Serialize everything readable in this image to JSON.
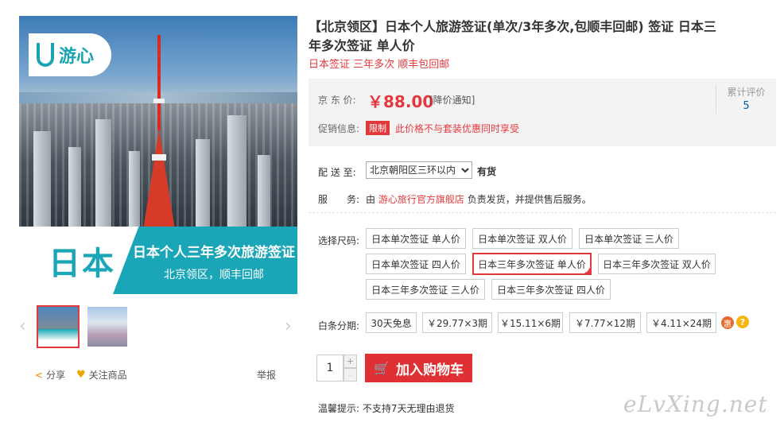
{
  "gallery": {
    "brand_logo": "游心",
    "banner_left": "日本",
    "banner_title": "日本个人三年多次旅游签证",
    "banner_subtitle": "北京领区，顺丰回邮"
  },
  "actions": {
    "share": "分享",
    "follow": "关注商品",
    "report": "举报"
  },
  "product": {
    "title": "【北京领区】日本个人旅游签证(单次/3年多次,包顺丰回邮) 签证 日本三年多次签证 单人价",
    "subtitle": "日本签证 三年多次 顺丰包回邮"
  },
  "price_section": {
    "label": "京 东 价:",
    "price": "￥88.00",
    "notice": "[降价通知]",
    "promo_label": "促销信息:",
    "promo_tag": "限制",
    "promo_text": "此价格不与套装优惠同时享受",
    "review_label": "累计评价",
    "review_count": "5"
  },
  "shipping": {
    "label": "配 送 至:",
    "location": "北京朝阳区三环以内",
    "stock": "有货",
    "service_label": "服　　务:",
    "service_prefix": "由",
    "shop_name": "游心旅行官方旗舰店",
    "service_suffix": "负责发货，并提供售后服务。"
  },
  "sizes": {
    "label": "选择尺码:",
    "options": [
      "日本单次签证 单人价",
      "日本单次签证 双人价",
      "日本单次签证 三人价",
      "日本单次签证 四人价",
      "日本三年多次签证 单人价",
      "日本三年多次签证 双人价",
      "日本三年多次签证 三人价",
      "日本三年多次签证 四人价"
    ],
    "selected_index": 4
  },
  "installments": {
    "label": "白条分期:",
    "options": [
      "30天免息",
      "￥29.77×3期",
      "￥15.11×6期",
      "￥7.77×12期",
      "￥4.11×24期"
    ],
    "hui": "惠",
    "help": "?"
  },
  "purchase": {
    "quantity": "1",
    "plus": "+",
    "minus": "-",
    "add_to_cart": "加入购物车"
  },
  "tip": {
    "label": "温馨提示:",
    "text": "不支持7天无理由退货"
  },
  "watermark": "eLvXing.net",
  "colors": {
    "accent_red": "#e4393c",
    "brand_teal": "#1aa6b7",
    "link_blue": "#005ea7"
  }
}
